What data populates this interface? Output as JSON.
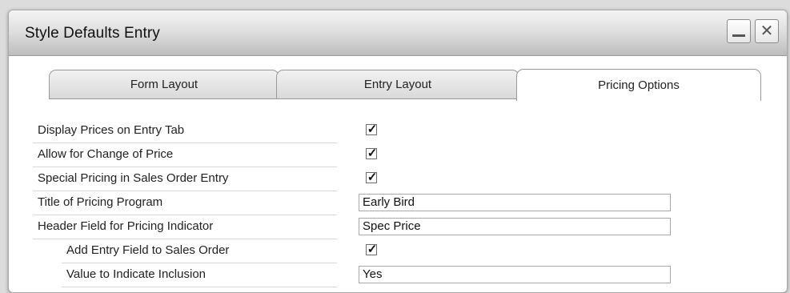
{
  "window": {
    "title": "Style Defaults Entry",
    "minimize_glyph": "_",
    "close_glyph": "✕"
  },
  "tabs": [
    {
      "label": "Form Layout",
      "selected": false
    },
    {
      "label": "Entry Layout",
      "selected": false
    },
    {
      "label": "Pricing Options",
      "selected": true
    }
  ],
  "pricing_options": {
    "display_prices": {
      "label": "Display Prices on Entry Tab",
      "checked": true
    },
    "allow_change": {
      "label": "Allow for Change of Price",
      "checked": true
    },
    "special_pricing": {
      "label": "Special Pricing in Sales Order Entry",
      "checked": true
    },
    "title_program": {
      "label": "Title of Pricing Program",
      "value": "Early Bird"
    },
    "header_field": {
      "label": "Header Field for Pricing Indicator",
      "value": "Spec Price"
    },
    "add_entry_field": {
      "label": "Add Entry Field to Sales Order",
      "checked": true
    },
    "value_indicate": {
      "label": "Value to Indicate Inclusion",
      "value": "Yes"
    }
  },
  "check_glyph": "✓"
}
